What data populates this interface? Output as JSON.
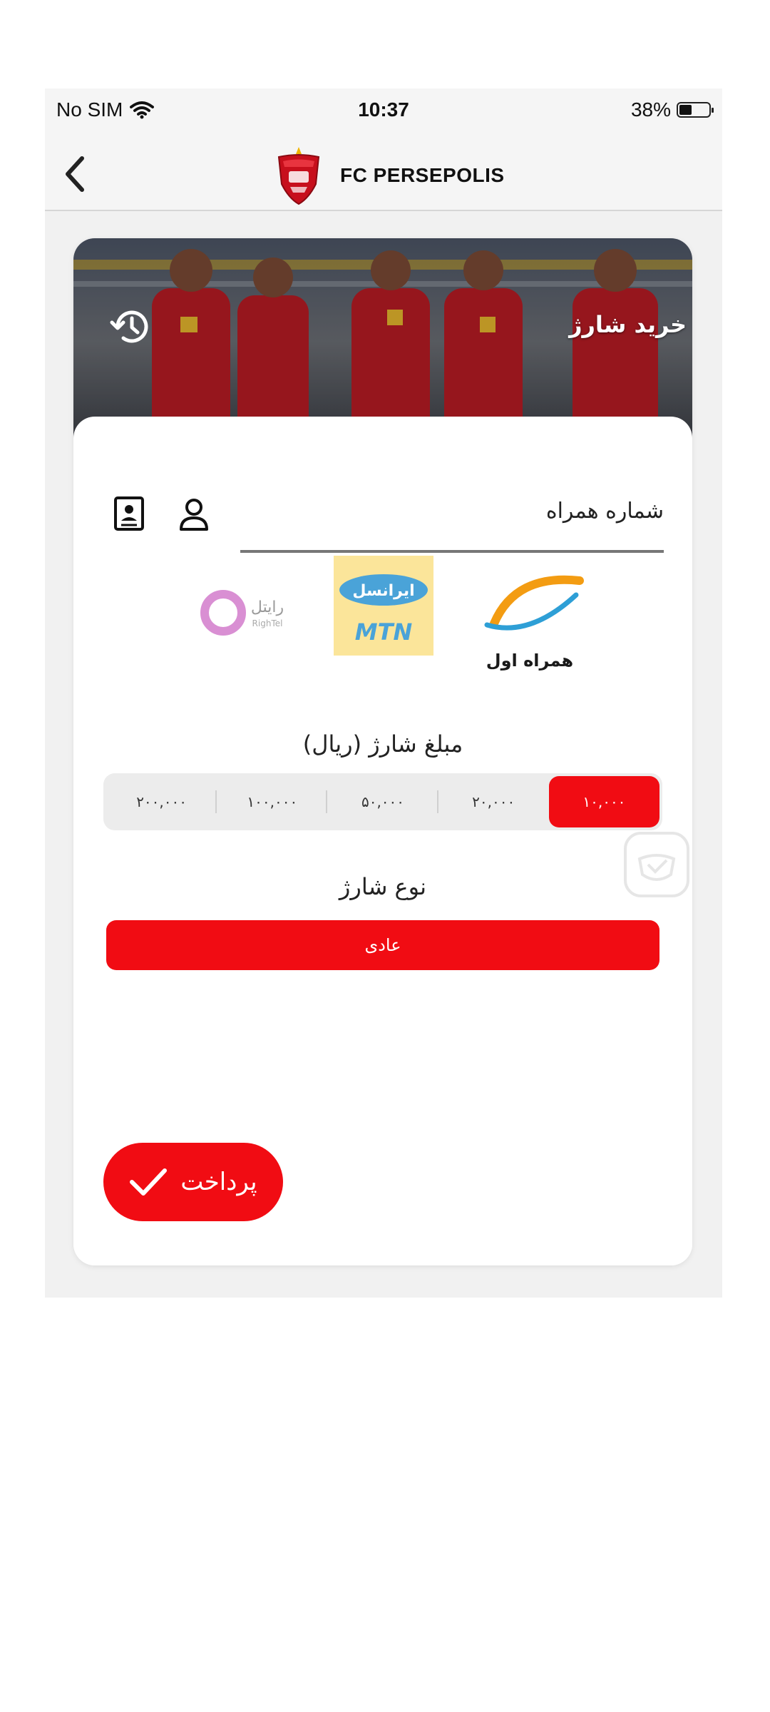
{
  "status": {
    "carrier": "No SIM",
    "time": "10:37",
    "battery_text": "38%",
    "battery_level": 0.38
  },
  "header": {
    "title": "FC PERSEPOLIS",
    "back_icon": "chevron-left-icon",
    "logo_icon": "persepolis-crest-icon"
  },
  "hero": {
    "title": "خرید شارژ",
    "history_icon": "history-icon"
  },
  "form": {
    "phone_label": "شماره همراه",
    "contact_icon": "contact-book-icon",
    "person_icon": "person-icon"
  },
  "operators": [
    {
      "name": "همراه اول",
      "brand_color": "#f39c12"
    },
    {
      "name": "ایرانسل",
      "subname": "MTN",
      "brand_color": "#fbe59a"
    },
    {
      "name": "رایتل",
      "subname": "RighTel",
      "brand_color": "#d98fd3"
    }
  ],
  "amount": {
    "title": "مبلغ شارژ (ریال)",
    "options": [
      "۱۰,۰۰۰",
      "۲۰,۰۰۰",
      "۵۰,۰۰۰",
      "۱۰۰,۰۰۰",
      "۲۰۰,۰۰۰"
    ],
    "selected_index": 0
  },
  "charge_type": {
    "title": "نوع شارژ",
    "selected": "عادی"
  },
  "pay_button": {
    "label": "پرداخت",
    "icon": "checkmark-icon"
  },
  "colors": {
    "accent": "#f10c13",
    "background": "#f1f1f1"
  }
}
